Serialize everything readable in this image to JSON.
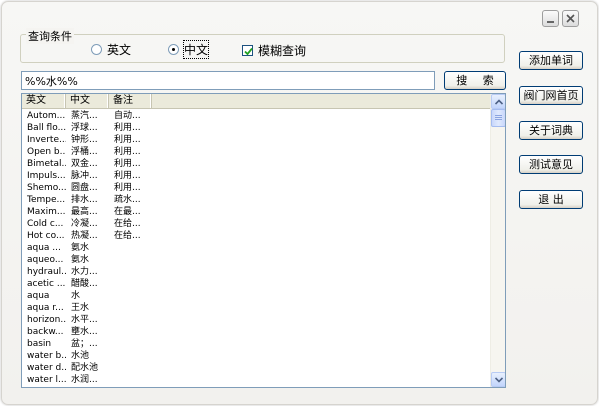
{
  "titlebar": {
    "minimize_icon": "minimize-icon",
    "close_icon": "close-icon"
  },
  "query": {
    "group_label": "查询条件",
    "radio_english": "英文",
    "radio_chinese": "中文",
    "selected_radio": "中文",
    "fuzzy_label": "模糊查询",
    "fuzzy_checked": true
  },
  "search": {
    "value": "%%水%%",
    "button_label": "搜 索"
  },
  "sidebar": {
    "add_word": "添加单词",
    "homepage": "阀门网首页",
    "about": "关于词典",
    "test": "测试意见",
    "exit": "退 出"
  },
  "table": {
    "headers": [
      "英文",
      "中文",
      "备注"
    ],
    "rows": [
      [
        "Autom...",
        "蒸汽...",
        "自动..."
      ],
      [
        "Ball flo...",
        "浮球...",
        "利用..."
      ],
      [
        "Inverte...",
        "钟形...",
        "利用..."
      ],
      [
        "Open b...",
        "浮桶...",
        "利用..."
      ],
      [
        "Bimetal...",
        "双金...",
        "利用..."
      ],
      [
        "Impuls...",
        "脉冲...",
        "利用..."
      ],
      [
        "Shemo...",
        "圆盘...",
        "利用..."
      ],
      [
        "Tempe...",
        "排水...",
        "疏水..."
      ],
      [
        "Maxim...",
        "最高...",
        "在最..."
      ],
      [
        "Cold c...",
        "冷凝...",
        "在给..."
      ],
      [
        "Hot co...",
        "热凝...",
        "在给..."
      ],
      [
        "aqua ...",
        "氨水",
        ""
      ],
      [
        "aqueo...",
        "氨水",
        ""
      ],
      [
        "hydraul...",
        "水力...",
        ""
      ],
      [
        "acetic ...",
        "醋酸...",
        ""
      ],
      [
        "aqua",
        "水",
        ""
      ],
      [
        "aqua r...",
        "王水",
        ""
      ],
      [
        "horizon...",
        "水平...",
        ""
      ],
      [
        "backw...",
        "壅水...",
        ""
      ],
      [
        "basin",
        "盆；...",
        ""
      ],
      [
        "water b...",
        "水池",
        ""
      ],
      [
        "water d...",
        "配水池",
        ""
      ],
      [
        "water l...",
        "水润...",
        ""
      ]
    ]
  },
  "colors": {
    "window_bg": "#f2f1ee",
    "button_border": "#003c74",
    "list_border": "#7f9db9"
  }
}
